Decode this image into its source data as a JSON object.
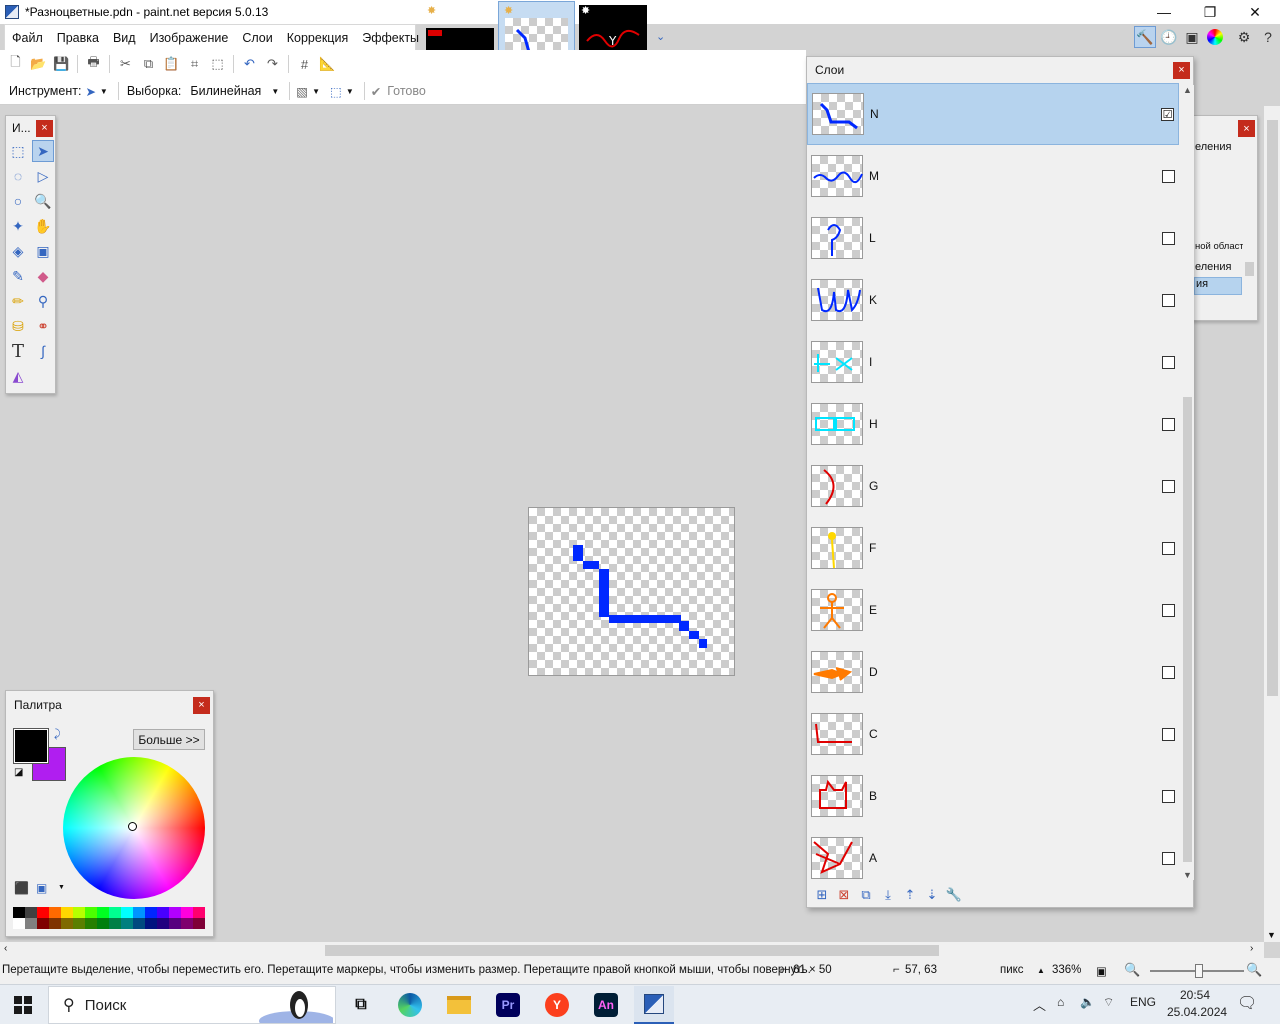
{
  "window": {
    "title": "*Разноцветные.pdn - paint.net версия 5.0.13",
    "controls": {
      "minimize": "—",
      "maximize": "❐",
      "close": "✕"
    }
  },
  "menu": [
    "Файл",
    "Правка",
    "Вид",
    "Изображение",
    "Слои",
    "Коррекция",
    "Эффекты"
  ],
  "options": {
    "tool_label": "Инструмент:",
    "selection_label": "Выборка:",
    "selection_value": "Билинейная",
    "done_label": "Готово"
  },
  "tools_panel": {
    "title": "И...",
    "close": "×"
  },
  "palette_panel": {
    "title": "Палитра",
    "close": "×",
    "more_button": "Больше >>",
    "primary_color": "#000000",
    "secondary_color": "#b01ef0",
    "swatches_top": [
      "#000000",
      "#404040",
      "#ff0000",
      "#ff6a00",
      "#ffd800",
      "#b6ff00",
      "#4cff00",
      "#00ff21",
      "#00ff90",
      "#00ffff",
      "#0094ff",
      "#0026ff",
      "#4800ff",
      "#b200ff",
      "#ff00dc",
      "#ff006e"
    ],
    "swatches_bottom": [
      "#ffffff",
      "#808080",
      "#7f0000",
      "#7f3300",
      "#7f6a00",
      "#5b7f00",
      "#267f00",
      "#007f0e",
      "#007f46",
      "#007f7f",
      "#004a7f",
      "#00137f",
      "#21007f",
      "#57007f",
      "#7f006e",
      "#7f0037"
    ]
  },
  "layers_panel": {
    "title": "Слои",
    "close": "×",
    "layers": [
      {
        "name": "N",
        "checked": true,
        "color": "#0028ff"
      },
      {
        "name": "M",
        "checked": false,
        "color": "#0028ff"
      },
      {
        "name": "L",
        "checked": false,
        "color": "#0028ff"
      },
      {
        "name": "K",
        "checked": false,
        "color": "#0028ff"
      },
      {
        "name": "I",
        "checked": false,
        "color": "#00e5ff"
      },
      {
        "name": "H",
        "checked": false,
        "color": "#00e5ff"
      },
      {
        "name": "G",
        "checked": false,
        "color": "#e00000"
      },
      {
        "name": "F",
        "checked": false,
        "color": "#ffd800"
      },
      {
        "name": "E",
        "checked": false,
        "color": "#ff7a00"
      },
      {
        "name": "D",
        "checked": false,
        "color": "#ff7a00"
      },
      {
        "name": "C",
        "checked": false,
        "color": "#e00000"
      },
      {
        "name": "B",
        "checked": false,
        "color": "#e00000"
      },
      {
        "name": "A",
        "checked": false,
        "color": "#e00000"
      }
    ]
  },
  "history_panel": {
    "close": "×",
    "items": [
      "еления",
      "ной области",
      "еления",
      "ия"
    ]
  },
  "status": {
    "hint": "Перетащите выделение, чтобы переместить его. Перетащите маркеры, чтобы изменить размер. Перетащите правой кнопкой мыши, чтобы повернуть.",
    "selection_size": "61 × 50",
    "cursor_pos": "57, 63",
    "units": "пикс",
    "zoom": "336%"
  },
  "taskbar": {
    "search_placeholder": "Поиск",
    "language": "ENG",
    "time": "20:54",
    "date": "25.04.2024",
    "apps": {
      "premiere": "Pr",
      "animate": "An"
    }
  }
}
